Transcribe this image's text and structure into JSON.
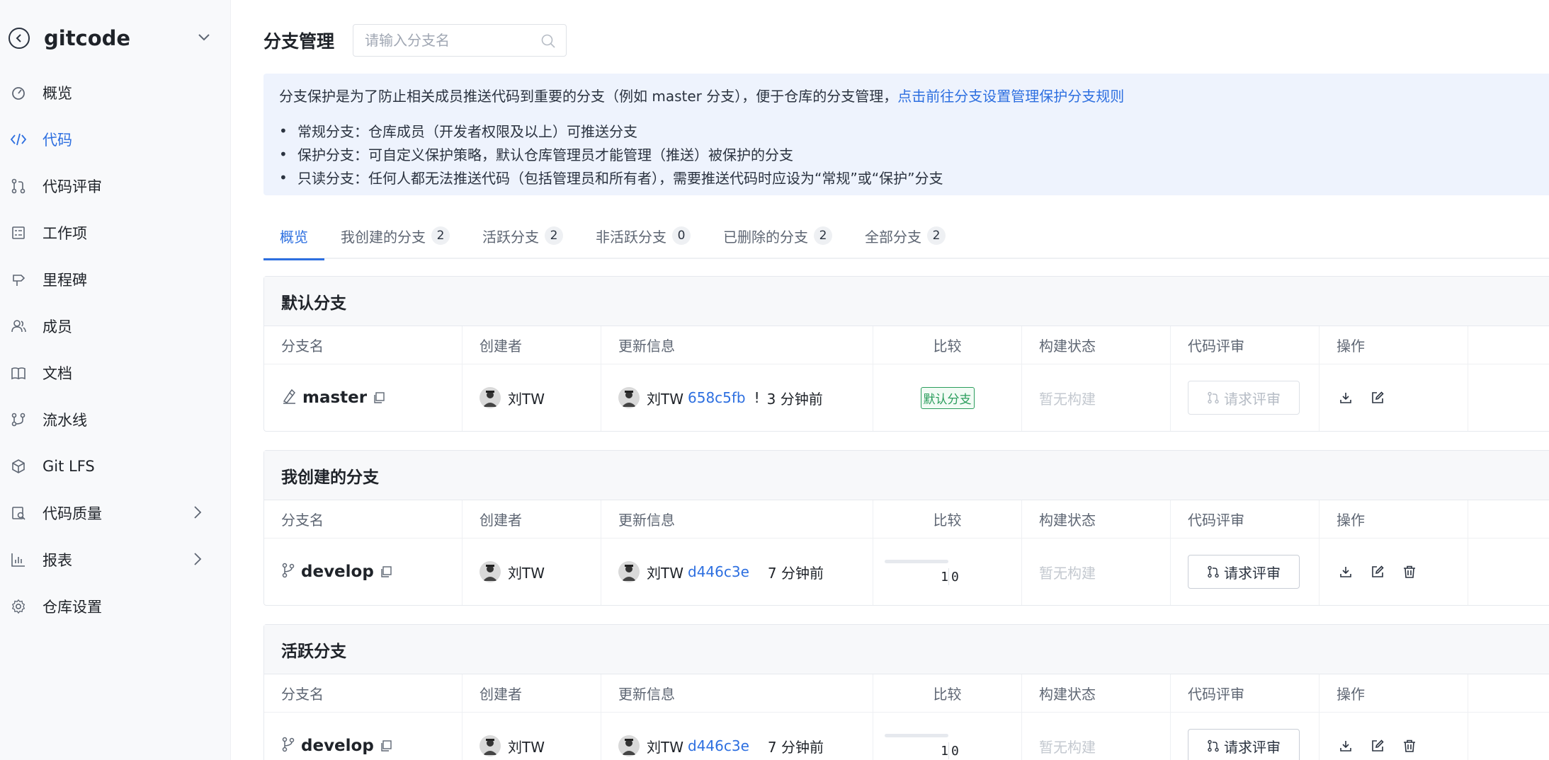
{
  "repo": {
    "name": "gitcode"
  },
  "sidebar": {
    "items": [
      {
        "label": "概览",
        "icon": "dashboard-icon"
      },
      {
        "label": "代码",
        "icon": "code-icon",
        "active": true
      },
      {
        "label": "代码评审",
        "icon": "merge-request-icon"
      },
      {
        "label": "工作项",
        "icon": "issue-icon"
      },
      {
        "label": "里程碑",
        "icon": "milestone-icon"
      },
      {
        "label": "成员",
        "icon": "members-icon"
      },
      {
        "label": "文档",
        "icon": "book-icon"
      },
      {
        "label": "流水线",
        "icon": "pipeline-icon"
      },
      {
        "label": "Git LFS",
        "icon": "cube-icon"
      },
      {
        "label": "代码质量",
        "icon": "quality-icon",
        "expandable": true
      },
      {
        "label": "报表",
        "icon": "chart-icon",
        "expandable": true
      },
      {
        "label": "仓库设置",
        "icon": "gear-icon"
      }
    ]
  },
  "header": {
    "title": "分支管理",
    "search_placeholder": "请输入分支名"
  },
  "info": {
    "main_text": "分支保护是为了防止相关成员推送代码到重要的分支（例如 master 分支），便于仓库的分支管理，",
    "link_text": "点击前往分支设置管理保护分支规则",
    "bullets": [
      "常规分支：仓库成员（开发者权限及以上）可推送分支",
      "保护分支：可自定义保护策略，默认仓库管理员才能管理（推送）被保护的分支",
      "只读分支：任何人都无法推送代码（包括管理员和所有者），需要推送代码时应设为“常规”或“保护”分支"
    ],
    "bullet_mark": "•"
  },
  "tabs": [
    {
      "label": "概览",
      "count": "",
      "active": true
    },
    {
      "label": "我创建的分支",
      "count": "2"
    },
    {
      "label": "活跃分支",
      "count": "2"
    },
    {
      "label": "非活跃分支",
      "count": "0"
    },
    {
      "label": "已删除的分支",
      "count": "2"
    },
    {
      "label": "全部分支",
      "count": "2"
    }
  ],
  "columns": {
    "name": "分支名",
    "creator": "创建者",
    "update": "更新信息",
    "compare": "比较",
    "build": "构建状态",
    "review": "代码评审",
    "ops": "操作"
  },
  "sections": [
    {
      "title": "默认分支",
      "row": {
        "branch": "master",
        "creator": "刘TW",
        "author": "刘TW",
        "commit": "658c5fb",
        "mark": "!",
        "time": "3 分钟前",
        "compare_badge": "默认分支",
        "build": "暂无构建",
        "review": "请求评审",
        "review_disabled": true
      }
    },
    {
      "title": "我创建的分支",
      "row": {
        "branch": "develop",
        "creator": "刘TW",
        "author": "刘TW",
        "commit": "d446c3e",
        "time": "7 分钟前",
        "behind": "1",
        "ahead": "0",
        "behind_fraction": 1,
        "build": "暂无构建",
        "review": "请求评审"
      }
    },
    {
      "title": "活跃分支",
      "row": {
        "branch": "develop",
        "creator": "刘TW",
        "author": "刘TW",
        "commit": "d446c3e",
        "time": "7 分钟前",
        "behind": "1",
        "ahead": "0",
        "behind_fraction": 1,
        "build": "暂无构建",
        "review": "请求评审"
      }
    }
  ],
  "colors": {
    "accent": "#2d6fe0",
    "badge_green": "#2a9d5c",
    "info_bg": "#eef3fd"
  }
}
